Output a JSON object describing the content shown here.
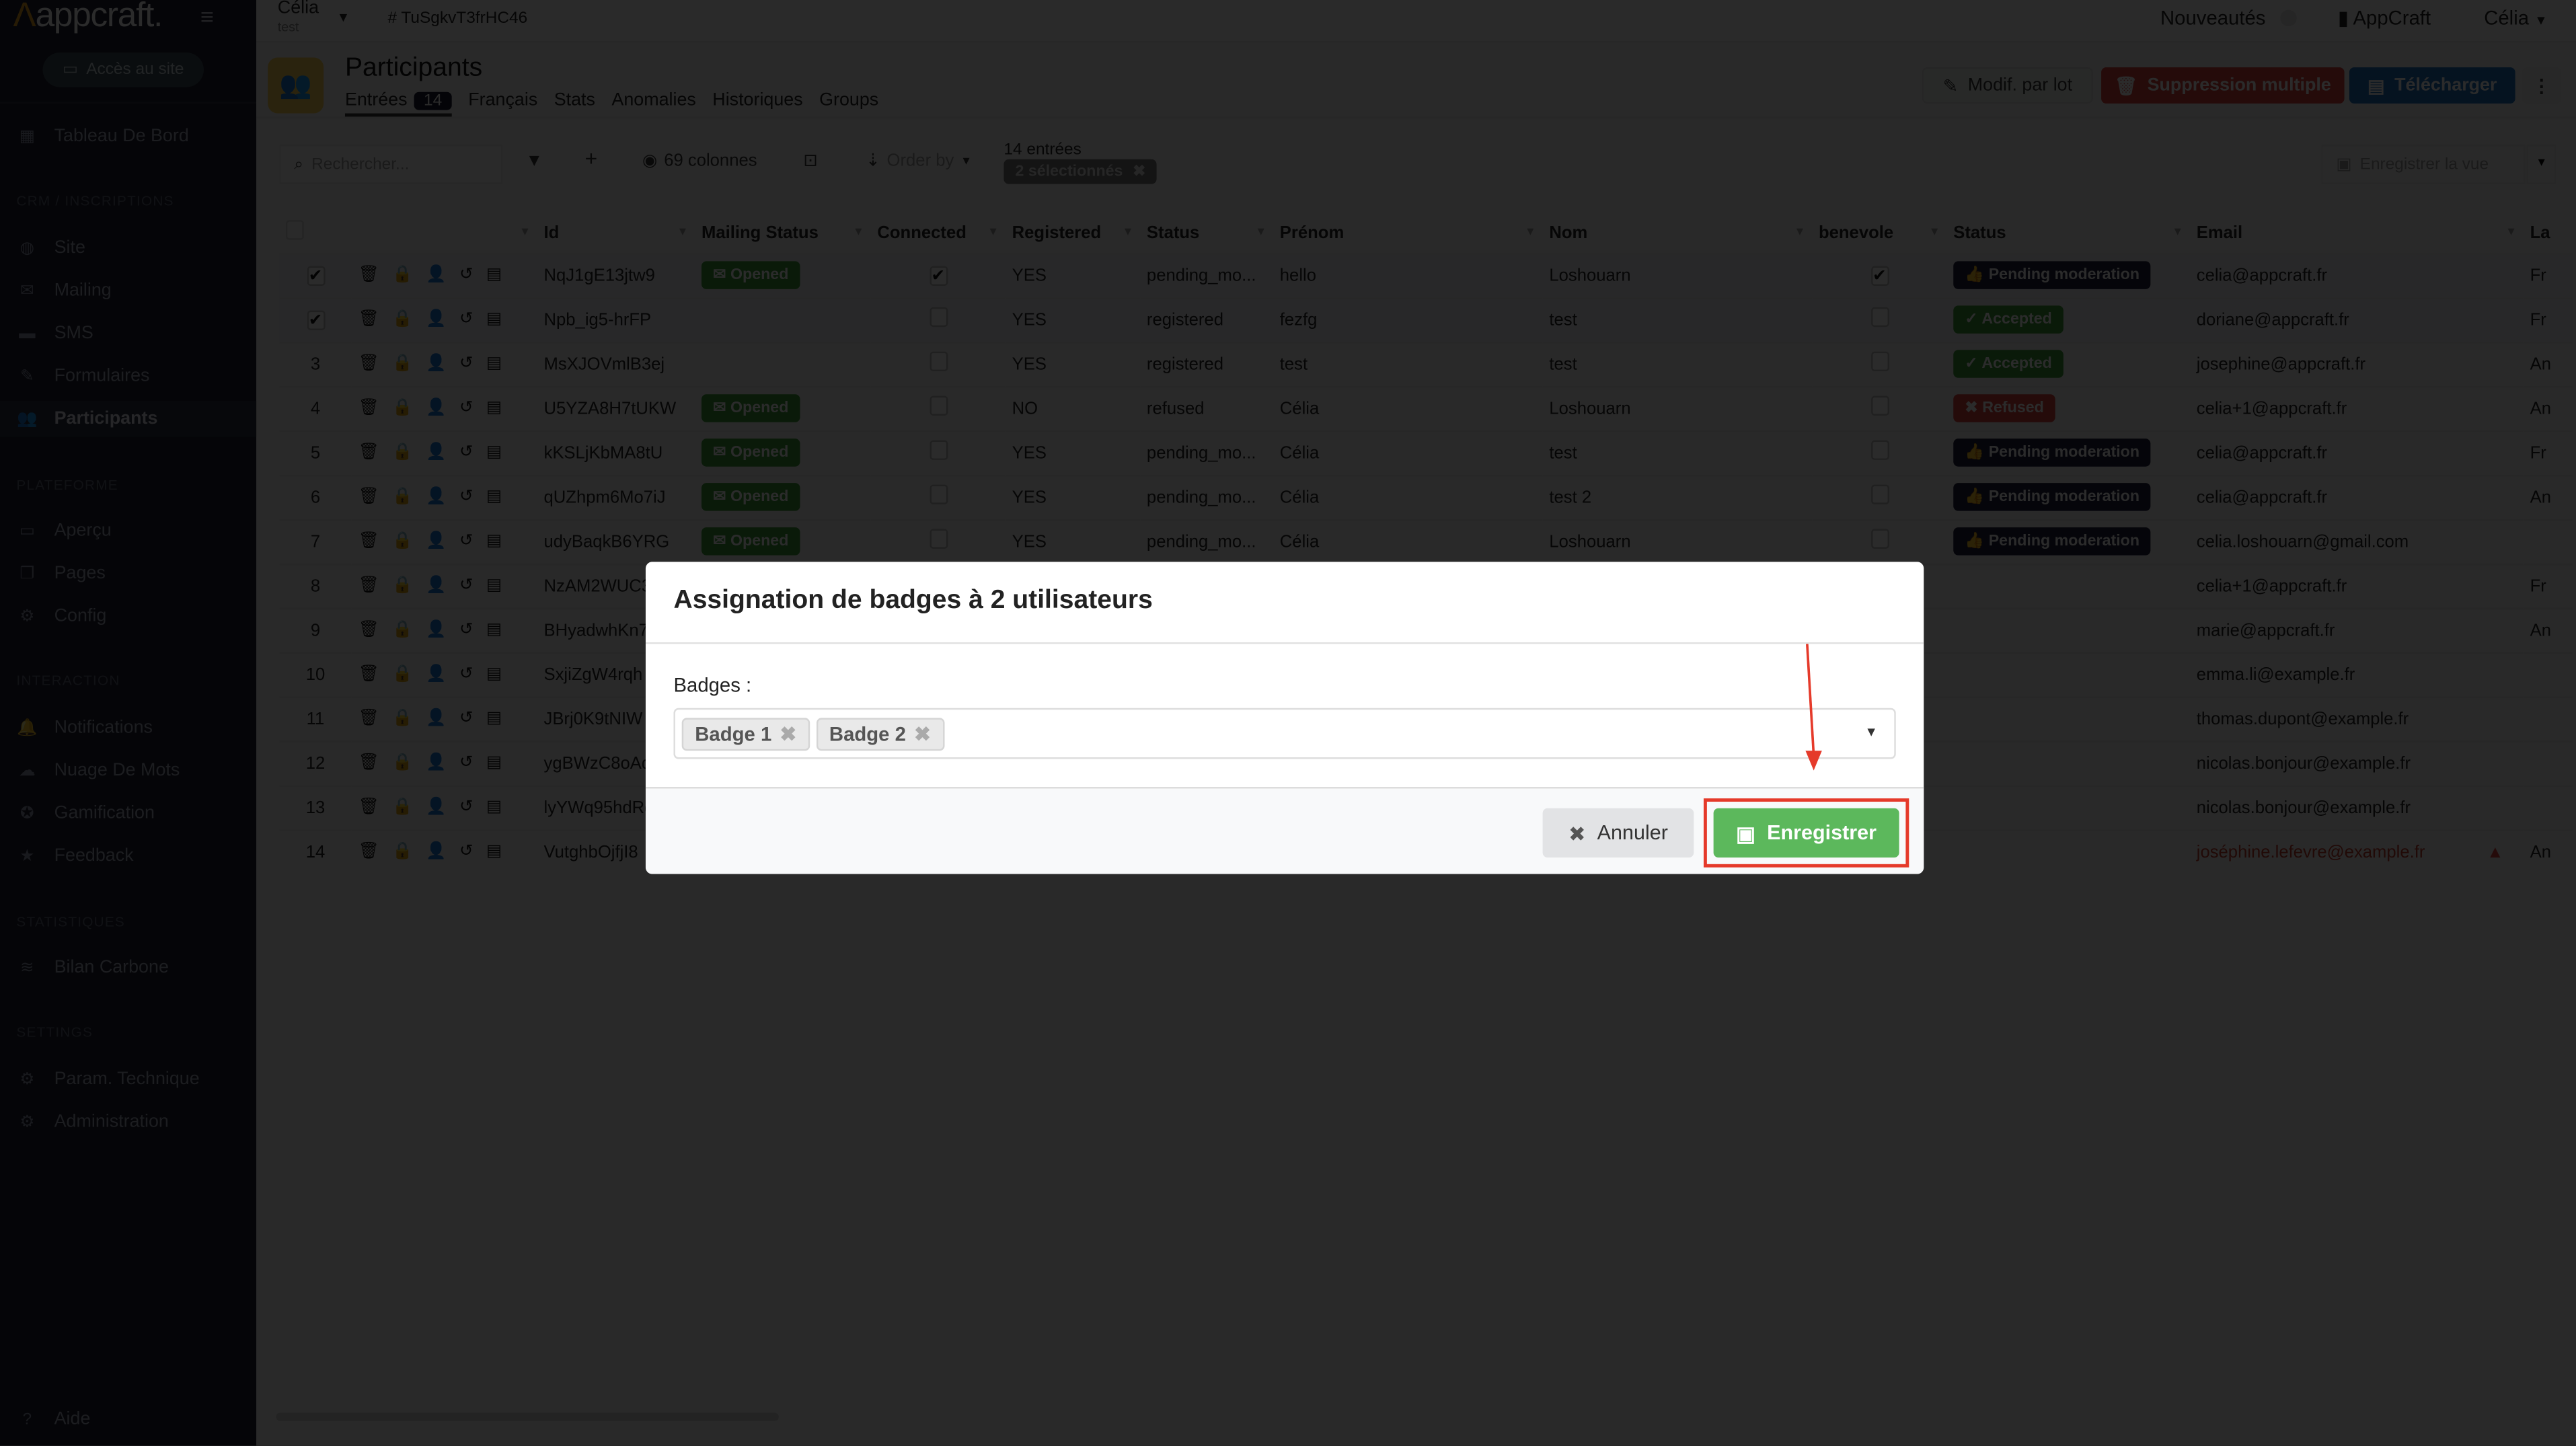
{
  "sidebar": {
    "logo": "appcraft.",
    "site_button": "Accès au site",
    "dashboard": "Tableau De Bord",
    "sections": [
      {
        "title": "CRM / INSCRIPTIONS",
        "items": [
          {
            "label": "Site",
            "icon": "globe-icon"
          },
          {
            "label": "Mailing",
            "icon": "envelope-icon"
          },
          {
            "label": "SMS",
            "icon": "sms-icon"
          },
          {
            "label": "Formulaires",
            "icon": "pencil-icon"
          },
          {
            "label": "Participants",
            "icon": "users-icon",
            "active": true
          }
        ]
      },
      {
        "title": "PLATEFORME",
        "items": [
          {
            "label": "Aperçu",
            "icon": "laptop-icon"
          },
          {
            "label": "Pages",
            "icon": "pages-icon"
          },
          {
            "label": "Config",
            "icon": "config-icon"
          }
        ]
      },
      {
        "title": "INTERACTION",
        "items": [
          {
            "label": "Notifications",
            "icon": "bell-icon"
          },
          {
            "label": "Nuage De Mots",
            "icon": "cloud-icon"
          },
          {
            "label": "Gamification",
            "icon": "star-circle-icon"
          },
          {
            "label": "Feedback",
            "icon": "star-icon"
          }
        ]
      },
      {
        "title": "STATISTIQUES",
        "items": [
          {
            "label": "Bilan Carbone",
            "icon": "chart-icon"
          }
        ]
      },
      {
        "title": "SETTINGS",
        "items": [
          {
            "label": "Param. Technique",
            "icon": "gear-box-icon"
          },
          {
            "label": "Administration",
            "icon": "gear-icon"
          }
        ]
      }
    ],
    "help": "Aide"
  },
  "topbar": {
    "project_name": "Célia",
    "project_sub": "test",
    "project_id": "# TuSgkvT3frHC46",
    "news": "Nouveautés",
    "org": "AppCraft",
    "user": "Célia"
  },
  "header": {
    "title": "Participants",
    "tabs": [
      {
        "label": "Entrées",
        "count": "14",
        "active": true
      },
      {
        "label": "Français"
      },
      {
        "label": "Stats"
      },
      {
        "label": "Anomalies"
      },
      {
        "label": "Historiques"
      },
      {
        "label": "Groups"
      }
    ],
    "actions": {
      "bulk_edit": "Modif. par lot",
      "bulk_delete": "Suppression multiple",
      "download": "Télécharger"
    }
  },
  "toolbar": {
    "search_placeholder": "Rechercher...",
    "columns": "69 colonnes",
    "order_by": "Order by",
    "entries": "14 entrées",
    "selected": "2 sélectionnés",
    "save_view": "Enregistrer la vue"
  },
  "table": {
    "columns": [
      "",
      "",
      "Id",
      "Mailing Status",
      "Connected",
      "Registered",
      "Status",
      "Prénom",
      "Nom",
      "benevole",
      "Status",
      "Email",
      "La"
    ],
    "rows": [
      {
        "n": "1",
        "sel": true,
        "id": "NqJ1gE13jtw9",
        "mail": "Opened",
        "conn": true,
        "reg": "YES",
        "status": "pending_mo...",
        "prenom": "hello",
        "nom": "Loshouarn",
        "ben": true,
        "mod": "Pending moderation",
        "email": "celia@appcraft.fr",
        "la": "Fr"
      },
      {
        "n": "2",
        "sel": true,
        "id": "Npb_ig5-hrFP",
        "mail": "",
        "conn": false,
        "reg": "YES",
        "status": "registered",
        "prenom": "fezfg",
        "nom": "test",
        "ben": false,
        "mod": "Accepted",
        "email": "doriane@appcraft.fr",
        "la": "Fr"
      },
      {
        "n": "3",
        "id": "MsXJOVmlB3ej",
        "mail": "",
        "conn": false,
        "reg": "YES",
        "status": "registered",
        "prenom": "test",
        "nom": "test",
        "ben": false,
        "mod": "Accepted",
        "email": "josephine@appcraft.fr",
        "la": "An"
      },
      {
        "n": "4",
        "id": "U5YZA8H7tUKW",
        "mail": "Opened",
        "conn": false,
        "reg": "NO",
        "status": "refused",
        "prenom": "Célia",
        "nom": "Loshouarn",
        "ben": false,
        "mod": "Refused",
        "email": "celia+1@appcraft.fr",
        "la": "An"
      },
      {
        "n": "5",
        "id": "kKSLjKbMA8tU",
        "mail": "Opened",
        "conn": false,
        "reg": "YES",
        "status": "pending_mo...",
        "prenom": "Célia",
        "nom": "test",
        "ben": false,
        "mod": "Pending moderation",
        "email": "celia@appcraft.fr",
        "la": "Fr"
      },
      {
        "n": "6",
        "id": "qUZhpm6Mo7iJ",
        "mail": "Opened",
        "conn": false,
        "reg": "YES",
        "status": "pending_mo...",
        "prenom": "Célia",
        "nom": "test 2",
        "ben": false,
        "mod": "Pending moderation",
        "email": "celia@appcraft.fr",
        "la": "An"
      },
      {
        "n": "7",
        "id": "udyBaqkB6YRG",
        "mail": "Opened",
        "conn": false,
        "reg": "YES",
        "status": "pending_mo...",
        "prenom": "Célia",
        "nom": "Loshouarn",
        "ben": false,
        "mod": "Pending moderation",
        "email": "celia.loshouarn@gmail.com",
        "la": ""
      },
      {
        "n": "8",
        "id": "NzAM2WUC3",
        "email": "celia+1@appcraft.fr",
        "la": "Fr"
      },
      {
        "n": "9",
        "id": "BHyadwhKn7",
        "email": "marie@appcraft.fr",
        "la": "An"
      },
      {
        "n": "10",
        "id": "SxjiZgW4rqh",
        "email": "emma.li@example.fr",
        "la": ""
      },
      {
        "n": "11",
        "id": "JBrj0K9tNIW",
        "email": "thomas.dupont@example.fr",
        "la": ""
      },
      {
        "n": "12",
        "id": "ygBWzC8oAd",
        "email": "nicolas.bonjour@example.fr",
        "la": ""
      },
      {
        "n": "13",
        "id": "lyYWq95hdRg",
        "email": "nicolas.bonjour@example.fr",
        "la": ""
      },
      {
        "n": "14",
        "id": "VutghbOjfjI8",
        "email": "joséphine.lefevre@example.fr",
        "email_warning": true,
        "la": "An"
      }
    ]
  },
  "modal": {
    "title": "Assignation de badges à 2 utilisateurs",
    "label": "Badges :",
    "badges": [
      "Badge 1",
      "Badge 2"
    ],
    "cancel": "Annuler",
    "save": "Enregistrer"
  },
  "colors": {
    "save_green": "#5cb85c",
    "highlight_red": "#e53a2a",
    "delete_red": "#d9433b",
    "download_blue": "#1f6fbf",
    "opened_green": "#3a9b34"
  }
}
